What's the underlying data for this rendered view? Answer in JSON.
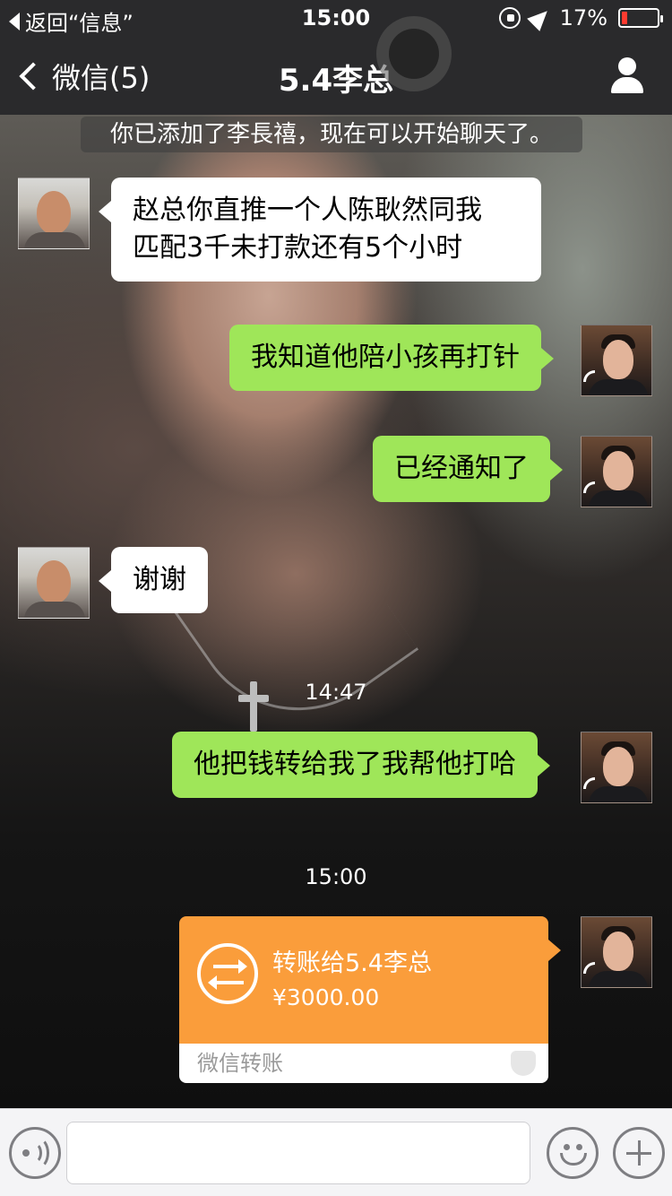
{
  "status_bar": {
    "back_label": "返回“信息”",
    "time": "15:00",
    "battery_percent": "17%",
    "battery_level": 0.17
  },
  "nav": {
    "back_label": "微信(5)",
    "title": "5.4李总"
  },
  "system_note": "你已添加了李長禧，现在可以开始聊天了。",
  "messages": [
    {
      "from": "them",
      "text_line1": "赵总你直推一个人陈耿然同我",
      "text_line2": "匹配3千未打款还有5个小时"
    },
    {
      "from": "me",
      "text": "我知道他陪小孩再打针"
    },
    {
      "from": "me",
      "text": "已经通知了"
    },
    {
      "from": "them",
      "text": "谢谢"
    },
    {
      "from": "me",
      "text": "他把钱转给我了我帮他打哈"
    }
  ],
  "timestamps": [
    "14:47",
    "15:00"
  ],
  "transfer": {
    "to_label": "转账给5.4李总",
    "amount": "¥3000.00",
    "footer": "微信转账"
  },
  "colors": {
    "bubble_mine": "#9fe659",
    "bubble_theirs": "#ffffff",
    "transfer_orange": "#fa9d3b",
    "navbar": "#2a2a2c"
  },
  "input": {
    "value": ""
  }
}
